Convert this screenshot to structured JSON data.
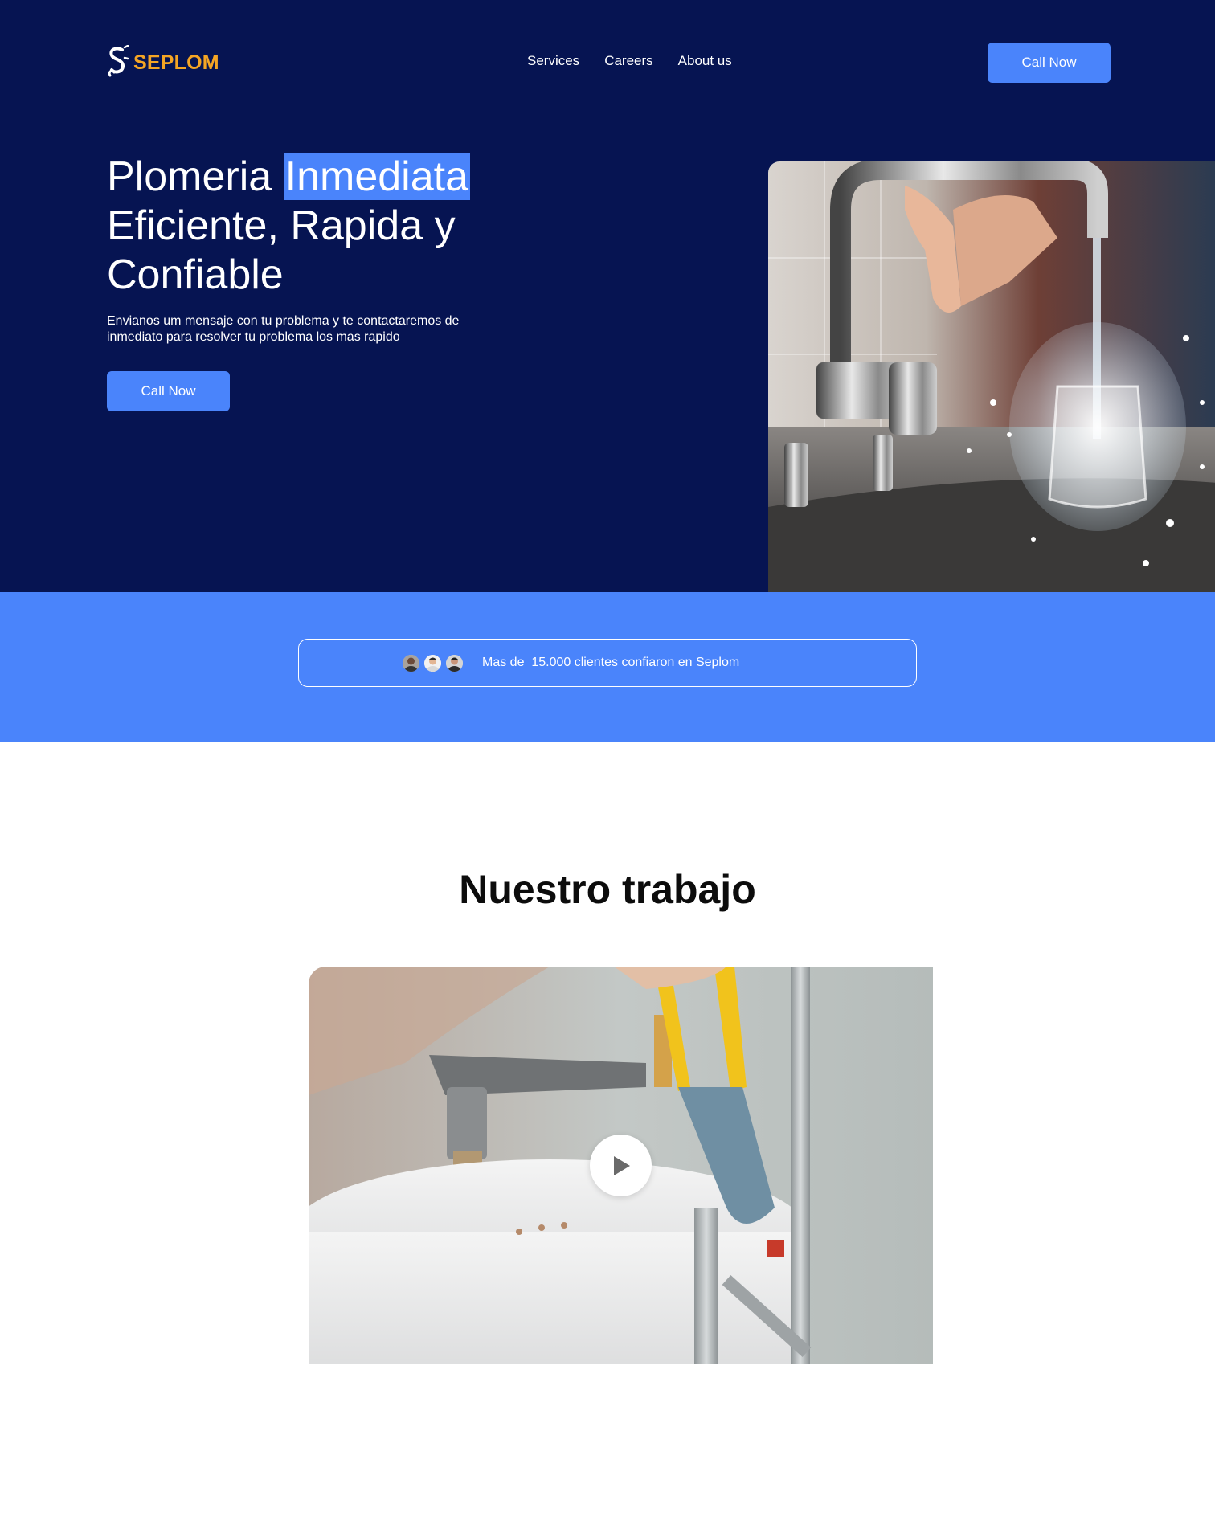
{
  "brand": {
    "name": "SEPLOM",
    "accent": "#F5A524",
    "primary": "#4A84FB",
    "navy": "#061452"
  },
  "nav": {
    "items": [
      "Services",
      "Careers",
      "About us"
    ]
  },
  "header": {
    "cta_label": "Call Now"
  },
  "hero": {
    "title_part1": "Plomeria ",
    "title_highlight": "Inmediata",
    "title_part2": "Eficiente, Rapida y Confiable",
    "subtitle": "Envianos um mensaje con tu problema y te contactaremos de inmediato para resolver tu problema los mas rapido",
    "cta_label": "Call Now",
    "image": "faucet-water-splash-photo"
  },
  "trust": {
    "text": "Mas de  15.000 clientes confiaron en Seplom",
    "avatar_count": 3
  },
  "work": {
    "title": "Nuestro trabajo",
    "video_thumbnail": "plumber-wrench-water-heater-photo",
    "play_icon": "play-icon"
  }
}
